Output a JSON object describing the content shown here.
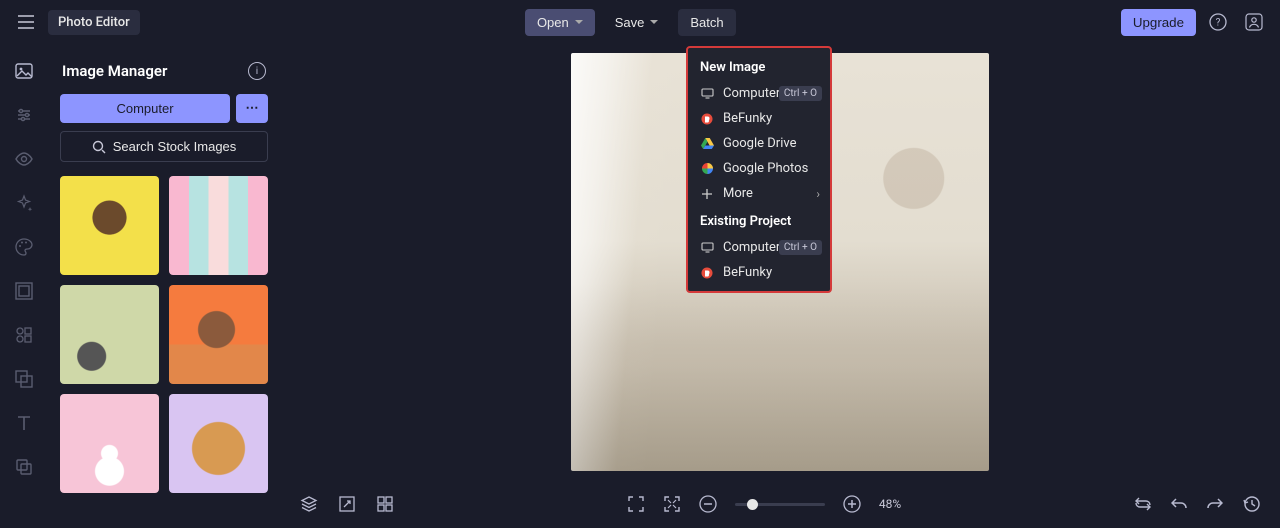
{
  "app": {
    "title": "Photo Editor"
  },
  "topbar": {
    "open": "Open",
    "save": "Save",
    "batch": "Batch",
    "upgrade": "Upgrade"
  },
  "panel": {
    "title": "Image Manager",
    "computer_btn": "Computer",
    "search_btn": "Search Stock Images"
  },
  "open_menu": {
    "section_new": "New Image",
    "computer": "Computer",
    "computer_shortcut": "Ctrl + O",
    "befunky": "BeFunky",
    "google_drive": "Google Drive",
    "google_photos": "Google Photos",
    "more": "More",
    "section_existing": "Existing Project",
    "existing_computer": "Computer",
    "existing_shortcut": "Ctrl + O",
    "existing_befunky": "BeFunky"
  },
  "zoom": {
    "value": "48%"
  }
}
